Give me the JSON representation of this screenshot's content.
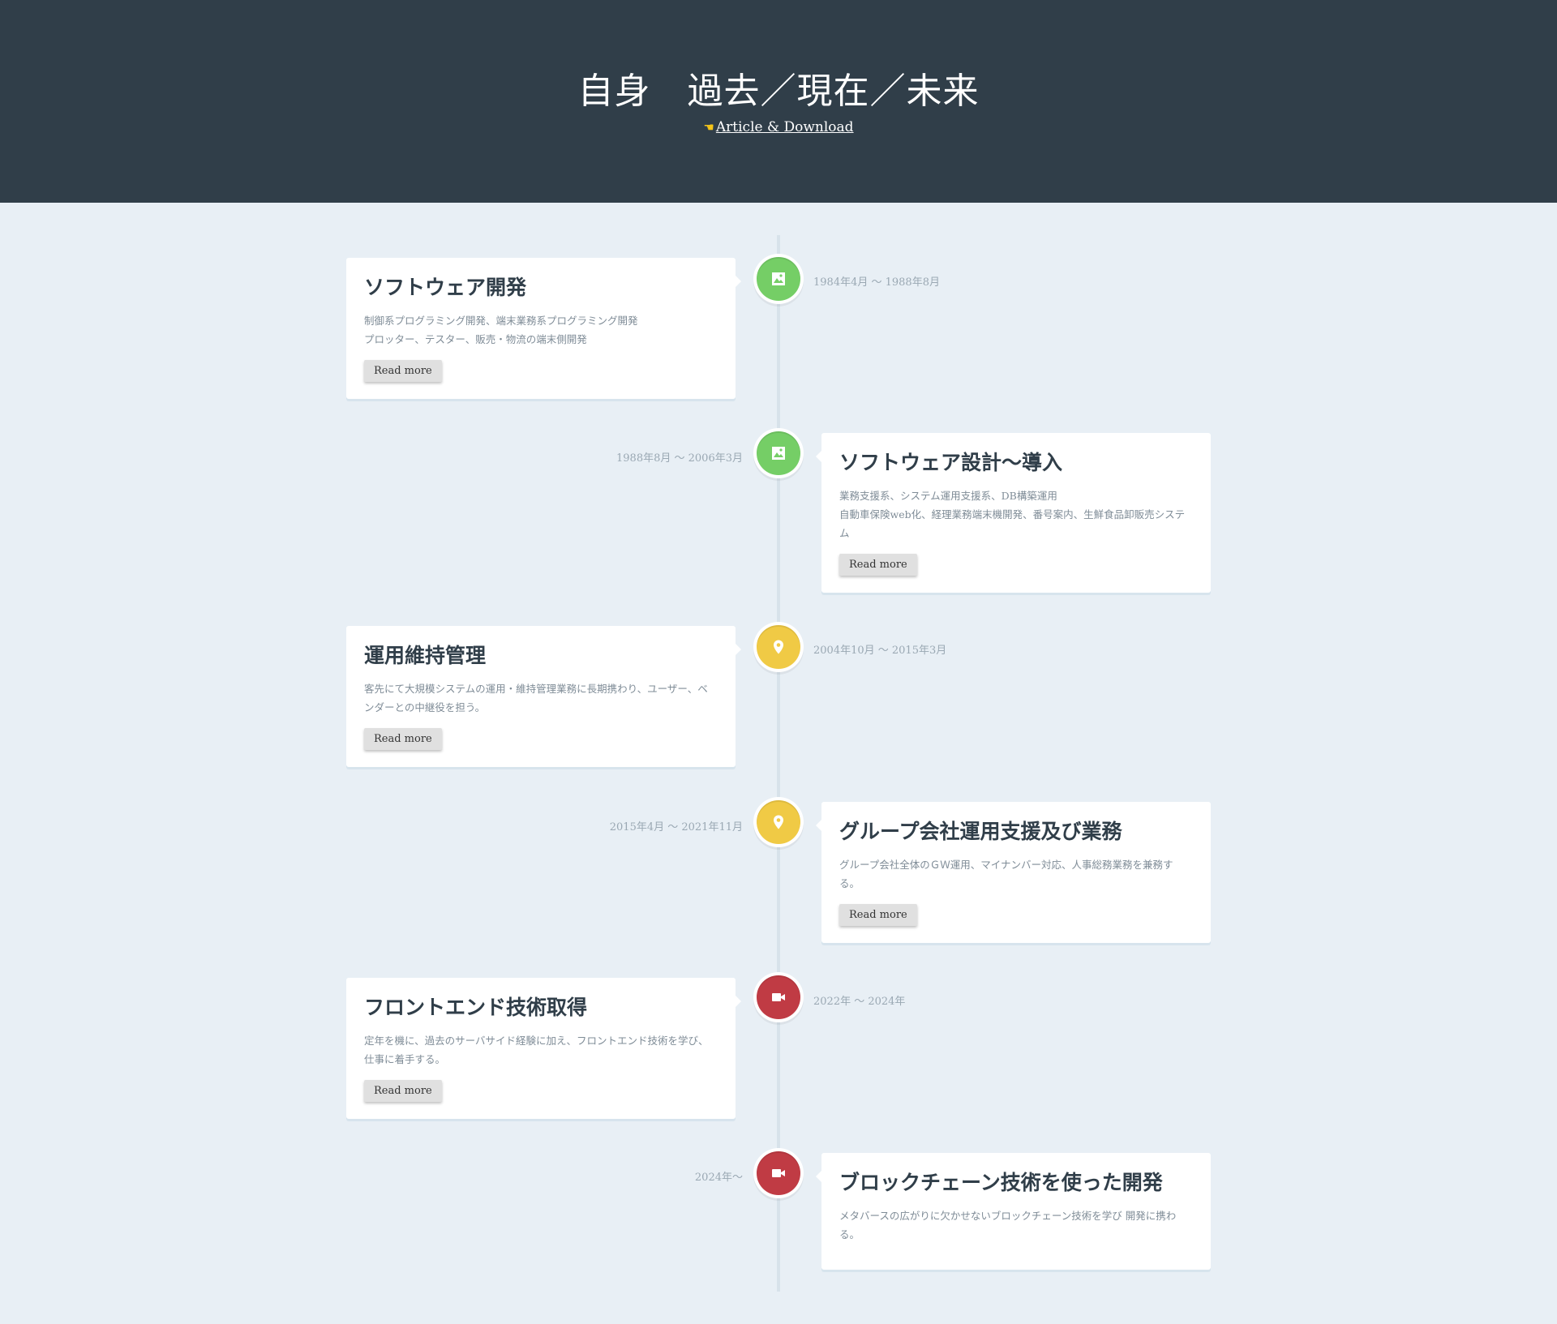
{
  "header": {
    "title": "自身　過去／現在／未来",
    "link_label": "Article & Download",
    "link_icon": "pointing-hand-icon"
  },
  "colors": {
    "header_bg": "#303e49",
    "page_bg": "#e8eff5",
    "marker_green": "#75ce66",
    "marker_yellow": "#f0ca45",
    "marker_red": "#c03b44"
  },
  "timeline": [
    {
      "side": "left",
      "marker_color": "green",
      "icon": "picture-icon",
      "title": "ソフトウェア開発",
      "lines": [
        "制御系プログラミング開発、端末業務系プログラミング開発",
        "プロッター、テスター、販売・物流の端末側開発"
      ],
      "button": "Read more",
      "date": "1984年4月 ～ 1988年8月"
    },
    {
      "side": "right",
      "marker_color": "green",
      "icon": "picture-icon",
      "title": "ソフトウェア設計～導入",
      "lines": [
        "業務支援系、システム運用支援系、DB構築運用",
        "自動車保険web化、経理業務端末機開発、番号案内、生鮮食品卸販売システム"
      ],
      "button": "Read more",
      "date": "1988年8月 ～ 2006年3月"
    },
    {
      "side": "left",
      "marker_color": "yellow",
      "icon": "location-pin-icon",
      "title": "運用維持管理",
      "lines": [
        "客先にて大規模システムの運用・維持管理業務に長期携わり、ユーザー、ベンダーとの中継役を担う。"
      ],
      "button": "Read more",
      "date": "2004年10月 ～ 2015年3月"
    },
    {
      "side": "right",
      "marker_color": "yellow",
      "icon": "location-pin-icon",
      "title": "グループ会社運用支援及び業務",
      "lines": [
        "グループ会社全体のＧＷ運用、マイナンバー対応、人事総務業務を兼務する。"
      ],
      "button": "Read more",
      "date": "2015年4月 ～ 2021年11月"
    },
    {
      "side": "left",
      "marker_color": "red",
      "icon": "video-camera-icon",
      "title": "フロントエンド技術取得",
      "lines": [
        "定年を機に、過去のサーバサイド経験に加え、フロントエンド技術を学び、仕事に着手する。"
      ],
      "button": "Read more",
      "date": "2022年 ～ 2024年"
    },
    {
      "side": "right",
      "marker_color": "red",
      "icon": "video-camera-icon",
      "title": "ブロックチェーン技術を使った開発",
      "lines": [
        "メタバースの広がりに欠かせないブロックチェーン技術を学び 開発に携わる。"
      ],
      "button": "",
      "date": "2024年～"
    }
  ]
}
